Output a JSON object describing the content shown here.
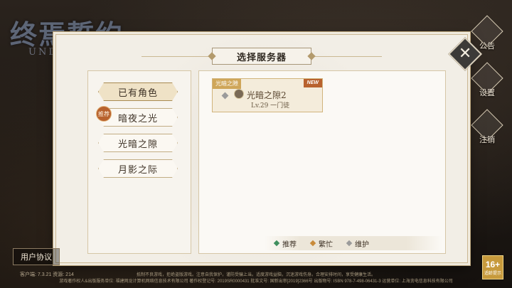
{
  "logo": {
    "title": "终焉誓约",
    "subtitle": "UNDE"
  },
  "side_menu": [
    {
      "label": "公告",
      "icon": "notice-icon"
    },
    {
      "label": "设置",
      "icon": "settings-icon"
    },
    {
      "label": "注销",
      "icon": "logout-icon"
    }
  ],
  "dialog": {
    "title": "选择服务器",
    "close_icon": "close-icon",
    "categories": [
      {
        "label": "已有角色",
        "active": true
      },
      {
        "label": "暗夜之光",
        "active": false,
        "tag": "推荐"
      },
      {
        "label": "光暗之隙",
        "active": false
      },
      {
        "label": "月影之际",
        "active": false
      }
    ],
    "servers": [
      {
        "zone": "光暗之隙",
        "name": "光暗之隙2",
        "info": "Lv.29 一门徒",
        "badge": "NEW",
        "status": "maintenance"
      }
    ],
    "legend": [
      {
        "label": "推荐",
        "color": "#3f8f5e"
      },
      {
        "label": "繁忙",
        "color": "#c98b3a"
      },
      {
        "label": "维护",
        "color": "#9b9b9b"
      }
    ]
  },
  "bottom": {
    "user_agreement": "用户协议",
    "version": "客户端: 7.3.21   资源: 214",
    "notice_line1": "抵制不良游戏，拒绝盗版游戏。注意自我保护，谨防受骗上当。适度游戏益脑，沉迷游戏伤身。合理安排时间，享受健康生活。",
    "notice_line2": "游戏著作权人&出版服务单位: 福建网龙计算机网络信息技术有限公司  著作权登记号: 2019SR0000431  批准文号: 国新出审[2019]2366号  出版物号: ISBN 978-7-498-06431-3 运营单位: 上海贪电信息科技有限公司",
    "age_rating": "16+",
    "age_label": "适龄提示"
  }
}
